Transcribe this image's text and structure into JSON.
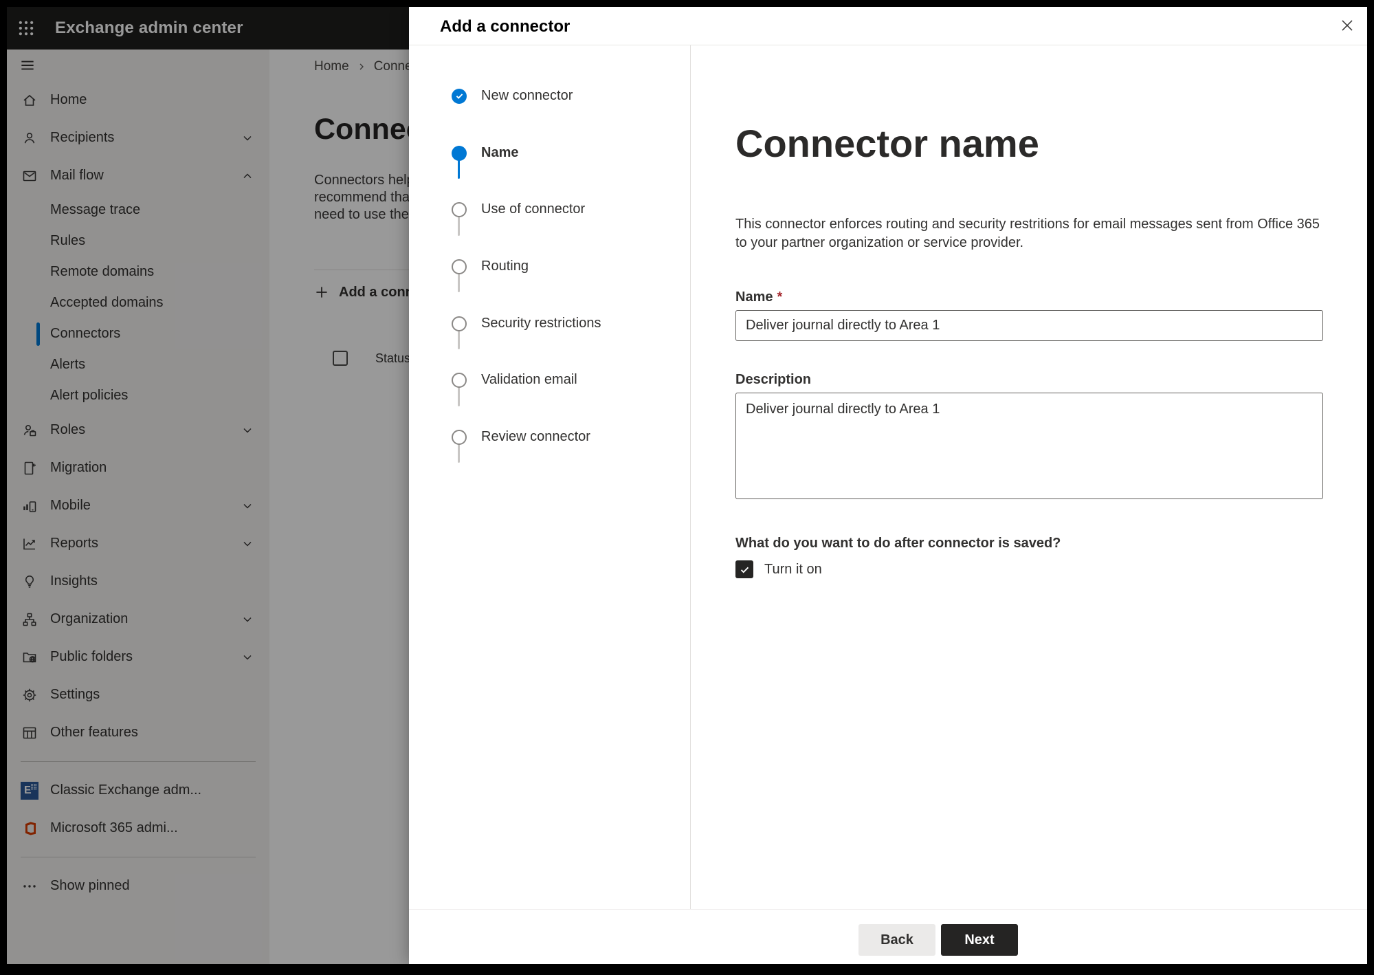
{
  "header": {
    "app_title": "Exchange admin center"
  },
  "sidebar": {
    "items": [
      {
        "label": "Home",
        "icon": "home"
      },
      {
        "label": "Recipients",
        "icon": "person",
        "chevron": "down"
      },
      {
        "label": "Mail flow",
        "icon": "mail",
        "chevron": "up",
        "expanded": true
      },
      {
        "label": "Message trace",
        "child": true
      },
      {
        "label": "Rules",
        "child": true
      },
      {
        "label": "Remote domains",
        "child": true
      },
      {
        "label": "Accepted domains",
        "child": true
      },
      {
        "label": "Connectors",
        "child": true,
        "selected": true
      },
      {
        "label": "Alerts",
        "child": true
      },
      {
        "label": "Alert policies",
        "child": true
      },
      {
        "label": "Roles",
        "icon": "roles",
        "chevron": "down"
      },
      {
        "label": "Migration",
        "icon": "migration"
      },
      {
        "label": "Mobile",
        "icon": "mobile",
        "chevron": "down"
      },
      {
        "label": "Reports",
        "icon": "reports",
        "chevron": "down"
      },
      {
        "label": "Insights",
        "icon": "lightbulb"
      },
      {
        "label": "Organization",
        "icon": "org-chart",
        "chevron": "down"
      },
      {
        "label": "Public folders",
        "icon": "folder-globe",
        "chevron": "down"
      },
      {
        "label": "Settings",
        "icon": "gear"
      },
      {
        "label": "Other features",
        "icon": "table"
      }
    ],
    "footer_items": [
      {
        "label": "Classic Exchange adm...",
        "icon": "exchange-logo"
      },
      {
        "label": "Microsoft 365 admi...",
        "icon": "office-logo"
      },
      {
        "label": "Show pinned",
        "icon": "ellipsis"
      }
    ]
  },
  "page": {
    "breadcrumb": [
      "Home",
      "Connectors"
    ],
    "title": "Connectors",
    "intro_lines": [
      "Connectors help",
      "recommend that",
      "need to use them"
    ],
    "add_button_label": "Add a connector",
    "table": {
      "columns": [
        "Status"
      ]
    }
  },
  "modal": {
    "title": "Add a connector",
    "steps": [
      {
        "label": "New connector",
        "state": "done"
      },
      {
        "label": "Name",
        "state": "current"
      },
      {
        "label": "Use of connector",
        "state": "todo"
      },
      {
        "label": "Routing",
        "state": "todo"
      },
      {
        "label": "Security restrictions",
        "state": "todo"
      },
      {
        "label": "Validation email",
        "state": "todo"
      },
      {
        "label": "Review connector",
        "state": "todo"
      }
    ],
    "content": {
      "heading": "Connector name",
      "description_lines": [
        "This connector enforces routing and security restritions for email messages sent from Office 365",
        "to your partner organization or service provider."
      ],
      "name_label": "Name",
      "required_mark": "*",
      "name_value": "Deliver journal directly to Area 1",
      "description_label": "Description",
      "description_value": "Deliver journal directly to Area 1",
      "after_save_question": "What do you want to do after connector is saved?",
      "turn_on_label": "Turn it on",
      "turn_on_checked": true
    },
    "footer": {
      "back_label": "Back",
      "next_label": "Next"
    }
  },
  "colors": {
    "accent": "#0078d4",
    "danger": "#a4262c",
    "primary_button": "#252423",
    "header_bg": "#1f1e1d",
    "exchange_brand": "#2b5797",
    "office_brand": "#d83b01"
  }
}
